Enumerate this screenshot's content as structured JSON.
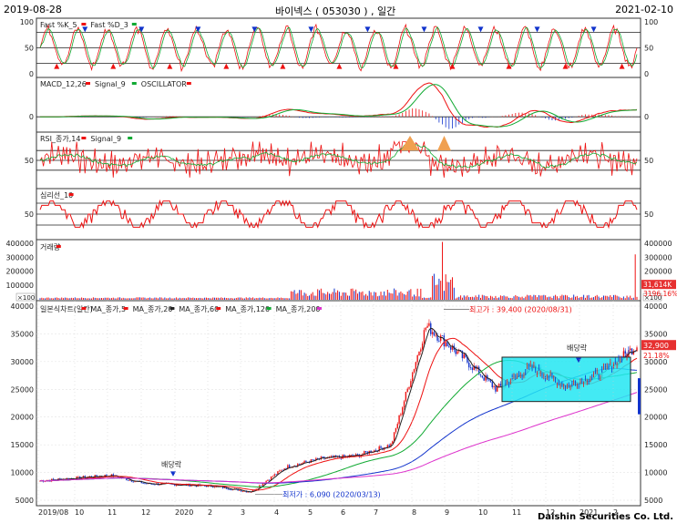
{
  "header": {
    "start_date": "2019-08-28",
    "title": "바이넥스 ( 053030 ) , 일간",
    "end_date": "2021-02-10",
    "footer": "Daishin Securities Co. Ltd."
  },
  "colors": {
    "red": "#ee1111",
    "blue": "#1133cc",
    "green": "#11aa33",
    "magenta": "#dd33cc",
    "cyan_box": "#22e6f2",
    "orange_fill": "#f0a050",
    "current_price_bg": "#e63030",
    "pane_border": "#333333"
  },
  "chart_data": [
    {
      "panel": "stochastic",
      "type": "line",
      "legend": [
        "Fast %K_5",
        "Fast %D_3"
      ],
      "series": [
        {
          "name": "Fast %K_5"
        },
        {
          "name": "Fast %D_3"
        }
      ],
      "ylim": [
        0,
        100
      ],
      "ticks": [
        "100",
        "50",
        "0"
      ],
      "right_ticks": [
        "100",
        "50",
        "0"
      ]
    },
    {
      "panel": "macd",
      "type": "line",
      "legend": [
        "MACD_12,26",
        "Signal_9",
        "OSCILLATOR"
      ],
      "series": [
        {
          "name": "MACD_12,26"
        },
        {
          "name": "Signal_9"
        },
        {
          "name": "OSCILLATOR"
        }
      ],
      "ticks": [
        "0"
      ],
      "right_ticks": [
        "0"
      ]
    },
    {
      "panel": "rsi",
      "type": "line",
      "legend": [
        "RSI_종가,14",
        "Signal_9"
      ],
      "series": [
        {
          "name": "RSI_종가,14"
        },
        {
          "name": "Signal_9"
        }
      ],
      "ylim": [
        0,
        100
      ],
      "ticks": [
        "50"
      ],
      "right_ticks": [
        "50"
      ]
    },
    {
      "panel": "psychological",
      "type": "line",
      "legend": [
        "심리선_10"
      ],
      "series": [
        {
          "name": "심리선_10"
        }
      ],
      "ylim": [
        0,
        100
      ],
      "ticks": [
        "50"
      ],
      "right_ticks": [
        "50"
      ]
    },
    {
      "panel": "volume",
      "type": "bar",
      "legend": [
        "거래량"
      ],
      "series": [
        {
          "name": "거래량"
        }
      ],
      "ylim": [
        0,
        400000
      ],
      "ticks": [
        "400000",
        "300000",
        "200000",
        "100000",
        "×100"
      ],
      "right_ticks": [
        "400000",
        "300000",
        "200000",
        "100000",
        "×100"
      ],
      "current_volume_label": "31,614K",
      "volume_change_label": "3196.16%"
    },
    {
      "panel": "price",
      "type": "line",
      "legend": [
        "일본식차트(일간)",
        "MA_종가,5",
        "MA_종가,20",
        "MA_종가,60",
        "MA_종가,120",
        "MA_종가,200"
      ],
      "series": [
        {
          "name": "일본식차트(일간)"
        },
        {
          "name": "MA_종가,5"
        },
        {
          "name": "MA_종가,20"
        },
        {
          "name": "MA_종가,60"
        },
        {
          "name": "MA_종가,120"
        },
        {
          "name": "MA_종가,200"
        }
      ],
      "ylim": [
        5000,
        40000
      ],
      "ticks": [
        "40000",
        "35000",
        "30000",
        "25000",
        "20000",
        "15000",
        "10000",
        "5000"
      ],
      "right_ticks": [
        "40000",
        "35000",
        "30000",
        "25000",
        "20000",
        "15000",
        "10000",
        "5000"
      ],
      "x_ticks": [
        "2019/08",
        "10",
        "11",
        "12",
        "2020",
        "2",
        "3",
        "4",
        "5",
        "6",
        "7",
        "8",
        "9",
        "10",
        "11",
        "12",
        "2021",
        "2"
      ],
      "high_label": "최고가 : 39,400 (2020/08/31)",
      "low_label": "최저가 : 6,090 (2020/03/13)",
      "dividend_label_1": "배당락",
      "dividend_label_2": "배당락",
      "current_price_label": "32,900",
      "percent_label": "21.18%",
      "price_keypoints": [
        {
          "date": "2019/08",
          "close": 8500
        },
        {
          "date": "2019/10",
          "close": 9000
        },
        {
          "date": "2019/11",
          "close": 9500
        },
        {
          "date": "2019/12",
          "close": 8000
        },
        {
          "date": "2020/01",
          "close": 7800
        },
        {
          "date": "2020/02",
          "close": 7500
        },
        {
          "date": "2020/03",
          "close": 6500
        },
        {
          "date": "2020/04",
          "close": 11000
        },
        {
          "date": "2020/05",
          "close": 12500
        },
        {
          "date": "2020/06",
          "close": 13000
        },
        {
          "date": "2020/07",
          "close": 15000
        },
        {
          "date": "2020/08",
          "close": 36500
        },
        {
          "date": "2020/09",
          "close": 31000
        },
        {
          "date": "2020/10",
          "close": 25000
        },
        {
          "date": "2020/11",
          "close": 29000
        },
        {
          "date": "2020/12",
          "close": 25500
        },
        {
          "date": "2021/01",
          "close": 28000
        },
        {
          "date": "2021/02",
          "close": 32900
        }
      ]
    }
  ]
}
